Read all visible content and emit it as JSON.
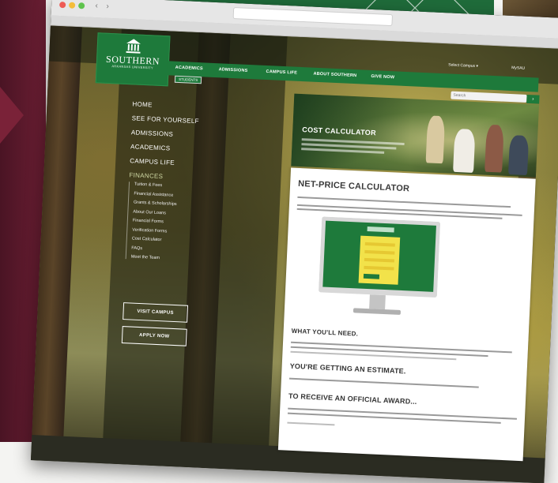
{
  "colors": {
    "brand_green": "#1e7a3b",
    "maroon": "#6b1e33",
    "heading_gray": "#3a3a3a",
    "white": "#ffffff"
  },
  "logo": {
    "name": "SOUTHERN",
    "subline": "ARKANSAS UNIVERSITY",
    "icon": "building-columns-icon"
  },
  "nav": {
    "items": [
      "ACADEMICS",
      "ADMISSIONS",
      "CAMPUS LIFE",
      "ABOUT SOUTHERN",
      "GIVE NOW"
    ],
    "subtab": "STUDENTS"
  },
  "top_links": {
    "select_campus": "Select Campus ▾",
    "my_sau": "MySAU"
  },
  "search": {
    "placeholder": "Search",
    "button_icon": "chevron-right-icon"
  },
  "sidebar": {
    "main_items": [
      "HOME",
      "SEE FOR YOURSELF",
      "ADMISSIONS",
      "ACADEMICS",
      "CAMPUS LIFE"
    ],
    "section": "FINANCES",
    "sub_items": [
      "Tuition & Fees",
      "Financial Assistance",
      "Grants & Scholarships",
      "About Our Loans",
      "Financial Forms",
      "Verification Forms",
      "Cost Calculator",
      "FAQs",
      "Meet the Team"
    ],
    "buttons": [
      "VISIT CAMPUS",
      "APPLY NOW"
    ]
  },
  "hero": {
    "title": "COST CALCULATOR"
  },
  "content": {
    "title": "NET-PRICE CALCULATOR",
    "headings": [
      "WHAT YOU'LL NEED.",
      "YOU'RE GETTING AN ESTIMATE.",
      "TO RECEIVE AN OFFICIAL AWARD..."
    ]
  }
}
